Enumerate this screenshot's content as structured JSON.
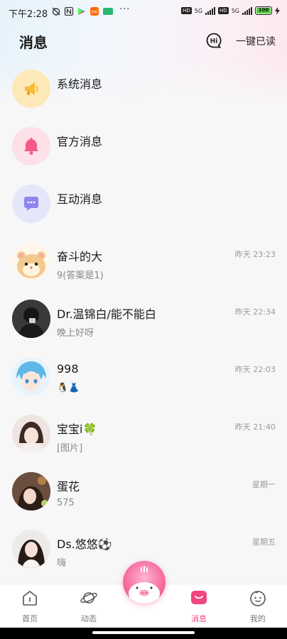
{
  "status_bar": {
    "time": "下午2:28",
    "more": "···",
    "battery": "100",
    "network": "5G"
  },
  "header": {
    "title": "消息",
    "mark_all_read": "一键已读",
    "hi_icon": "hi-bubble-icon"
  },
  "system_rows": [
    {
      "name": "系统消息",
      "icon": "megaphone-icon",
      "color": "#fde9b8"
    },
    {
      "name": "官方消息",
      "icon": "bell-icon",
      "color": "#fde0e8"
    },
    {
      "name": "互动消息",
      "icon": "chat-bubble-icon",
      "color": "#e6e6fb"
    }
  ],
  "conversations": [
    {
      "name": "奋斗的大",
      "preview": "9(答案是1)",
      "time": "昨天 23:23"
    },
    {
      "name": "Dr.温锦白/能不能白",
      "preview": "晚上好呀",
      "time": "昨天 22:34"
    },
    {
      "name": "998",
      "preview": "🐧👗",
      "time": "昨天 22:03"
    },
    {
      "name": "宝宝i🍀",
      "preview": "[图片]",
      "time": "昨天 21:40"
    },
    {
      "name": "蛋花",
      "preview": "575",
      "time": "星期一"
    },
    {
      "name": "Ds.悠悠⚽",
      "preview": "嗨",
      "time": "星期五"
    }
  ],
  "nav": {
    "home": "首页",
    "feed": "动态",
    "messages": "消息",
    "me": "我的",
    "active": "messages",
    "accent": "#f0457d"
  }
}
